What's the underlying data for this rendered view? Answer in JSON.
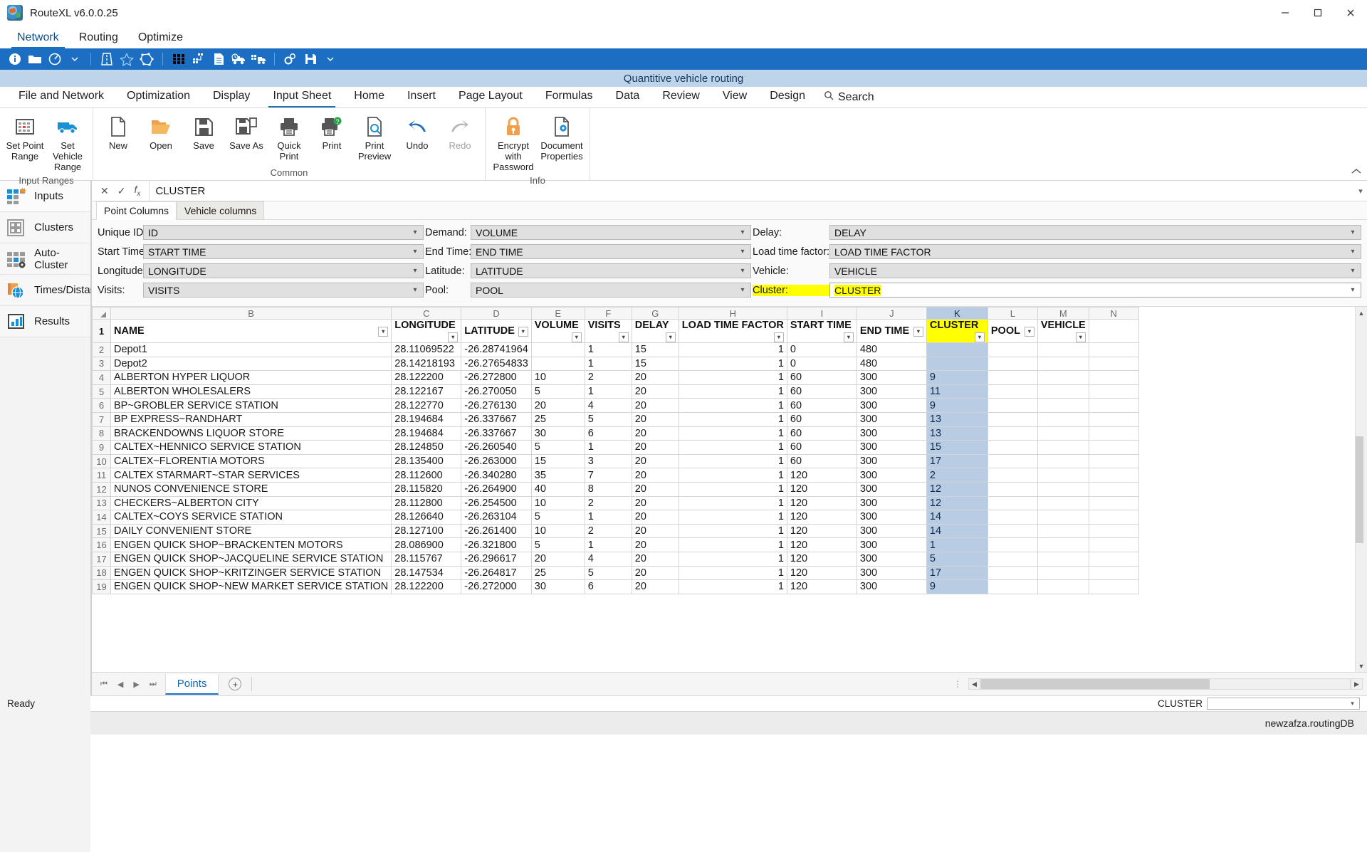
{
  "window": {
    "title": "RouteXL v6.0.0.25",
    "app_icon": "routexl-globe-icon",
    "minimize": "minimize-icon",
    "maximize": "maximize-icon",
    "close": "close-icon"
  },
  "menubar": {
    "items": [
      {
        "label": "Network",
        "active": true
      },
      {
        "label": "Routing",
        "active": false
      },
      {
        "label": "Optimize",
        "active": false
      }
    ]
  },
  "toolbar": {
    "icons": [
      "info-icon",
      "folder-open-icon",
      "compass-icon",
      "dropdown-caret-icon",
      "road-icon",
      "star-outline-icon",
      "polygon-icon",
      "grid-matrix-icon",
      "cluster-nodes-icon",
      "document-list-icon",
      "truck-clock-icon",
      "truck-network-icon",
      "gears-icon",
      "save-disk-icon",
      "more-caret-icon"
    ]
  },
  "caption": "Quantitive vehicle routing",
  "ribbon": {
    "tabs": [
      {
        "label": "File and Network",
        "active": false
      },
      {
        "label": "Optimization",
        "active": false
      },
      {
        "label": "Display",
        "active": false
      },
      {
        "label": "Input Sheet",
        "active": true
      },
      {
        "label": "Home",
        "active": false
      },
      {
        "label": "Insert",
        "active": false
      },
      {
        "label": "Page Layout",
        "active": false
      },
      {
        "label": "Formulas",
        "active": false
      },
      {
        "label": "Data",
        "active": false
      },
      {
        "label": "Review",
        "active": false
      },
      {
        "label": "View",
        "active": false
      },
      {
        "label": "Design",
        "active": false
      }
    ],
    "search_label": "Search",
    "search_icon": "search-icon",
    "groups": [
      {
        "title": "Input Ranges",
        "buttons": [
          {
            "label": "Set Point Range",
            "icon": "point-range-icon",
            "disabled": false
          },
          {
            "label": "Set Vehicle Range",
            "icon": "vehicle-range-icon",
            "disabled": false
          }
        ]
      },
      {
        "title": "Common",
        "buttons": [
          {
            "label": "New",
            "icon": "new-document-icon",
            "disabled": false
          },
          {
            "label": "Open",
            "icon": "open-folder-icon",
            "disabled": false
          },
          {
            "label": "Save",
            "icon": "save-disk-icon",
            "disabled": false
          },
          {
            "label": "Save As",
            "icon": "save-as-icon",
            "disabled": false
          },
          {
            "label": "Quick Print",
            "icon": "quick-print-icon",
            "disabled": false
          },
          {
            "label": "Print",
            "icon": "print-help-icon",
            "disabled": false
          },
          {
            "label": "Print Preview",
            "icon": "print-preview-icon",
            "disabled": false
          },
          {
            "label": "Undo",
            "icon": "undo-arrow-icon",
            "disabled": false
          },
          {
            "label": "Redo",
            "icon": "redo-arrow-icon",
            "disabled": true
          }
        ]
      },
      {
        "title": "Info",
        "buttons": [
          {
            "label": "Encrypt with Password",
            "icon": "lock-key-icon",
            "disabled": false
          },
          {
            "label": "Document Properties",
            "icon": "document-properties-icon",
            "disabled": false
          }
        ]
      }
    ]
  },
  "sidebar": {
    "items": [
      {
        "label": "Inputs",
        "icon": "inputs-icon",
        "selected": true
      },
      {
        "label": "Clusters",
        "icon": "clusters-icon",
        "selected": false
      },
      {
        "label": "Auto-Cluster",
        "icon": "auto-cluster-icon",
        "selected": false
      },
      {
        "label": "Times/Distances",
        "icon": "times-distances-icon",
        "selected": false
      },
      {
        "label": "Results",
        "icon": "results-chart-icon",
        "selected": false
      }
    ]
  },
  "formula_bar": {
    "cancel_icon": "cancel-x-icon",
    "confirm_icon": "confirm-check-icon",
    "function_icon": "fx-icon",
    "value": "CLUSTER",
    "expand_icon": "expand-caret-icon"
  },
  "config_panel": {
    "tabs": [
      {
        "label": "Point Columns",
        "active": true
      },
      {
        "label": "Vehicle columns",
        "active": false
      }
    ],
    "fields": [
      {
        "label": "Unique ID:",
        "value": "ID",
        "highlight_label": false,
        "highlight_value": false,
        "style": "combo"
      },
      {
        "label": "Demand:",
        "value": "VOLUME",
        "highlight_label": false,
        "highlight_value": false,
        "style": "combo"
      },
      {
        "label": "Delay:",
        "value": "DELAY",
        "highlight_label": false,
        "highlight_value": false,
        "style": "combo"
      },
      {
        "label": "Start Time:",
        "value": "START TIME",
        "highlight_label": false,
        "highlight_value": false,
        "style": "combo"
      },
      {
        "label": "End Time:",
        "value": "END TIME",
        "highlight_label": false,
        "highlight_value": false,
        "style": "combo"
      },
      {
        "label": "Load time factor:",
        "value": "LOAD TIME FACTOR",
        "highlight_label": false,
        "highlight_value": false,
        "style": "combo"
      },
      {
        "label": "Longitude:",
        "value": "LONGITUDE",
        "highlight_label": false,
        "highlight_value": false,
        "style": "combo"
      },
      {
        "label": "Latitude:",
        "value": "LATITUDE",
        "highlight_label": false,
        "highlight_value": false,
        "style": "combo"
      },
      {
        "label": "Vehicle:",
        "value": "VEHICLE",
        "highlight_label": false,
        "highlight_value": false,
        "style": "combo"
      },
      {
        "label": "Visits:",
        "value": "VISITS",
        "highlight_label": false,
        "highlight_value": false,
        "style": "combo"
      },
      {
        "label": "Pool:",
        "value": "POOL",
        "highlight_label": false,
        "highlight_value": false,
        "style": "combo"
      },
      {
        "label": "Cluster:",
        "value": "CLUSTER",
        "highlight_label": true,
        "highlight_value": true,
        "style": "plain"
      }
    ]
  },
  "sheet": {
    "column_letters": [
      "B",
      "C",
      "D",
      "E",
      "F",
      "G",
      "H",
      "I",
      "J",
      "K",
      "L",
      "M",
      "N"
    ],
    "headers": [
      "NAME",
      "LONGITUDE",
      "LATITUDE",
      "VOLUME",
      "VISITS",
      "DELAY",
      "LOAD TIME FACTOR",
      "START TIME",
      "END TIME",
      "CLUSTER",
      "POOL",
      "VEHICLE",
      ""
    ],
    "header_row_number": "1",
    "selected_column": "K",
    "selected_column_header": "CLUSTER",
    "rows": [
      {
        "n": "2",
        "cells": [
          "Depot1",
          "28.11069522",
          "-26.28741964",
          "",
          "1",
          "15",
          "1",
          "0",
          "480",
          "",
          "",
          "",
          ""
        ]
      },
      {
        "n": "3",
        "cells": [
          "Depot2",
          "28.14218193",
          "-26.27654833",
          "",
          "1",
          "15",
          "1",
          "0",
          "480",
          "",
          "",
          "",
          ""
        ]
      },
      {
        "n": "4",
        "cells": [
          "ALBERTON HYPER LIQUOR",
          "28.122200",
          "-26.272800",
          "10",
          "2",
          "20",
          "1",
          "60",
          "300",
          "9",
          "",
          "",
          ""
        ]
      },
      {
        "n": "5",
        "cells": [
          "ALBERTON WHOLESALERS",
          "28.122167",
          "-26.270050",
          "5",
          "1",
          "20",
          "1",
          "60",
          "300",
          "11",
          "",
          "",
          ""
        ]
      },
      {
        "n": "6",
        "cells": [
          "BP~GROBLER SERVICE STATION",
          "28.122770",
          "-26.276130",
          "20",
          "4",
          "20",
          "1",
          "60",
          "300",
          "9",
          "",
          "",
          ""
        ]
      },
      {
        "n": "7",
        "cells": [
          "BP EXPRESS~RANDHART",
          "28.194684",
          "-26.337667",
          "25",
          "5",
          "20",
          "1",
          "60",
          "300",
          "13",
          "",
          "",
          ""
        ]
      },
      {
        "n": "8",
        "cells": [
          "BRACKENDOWNS LIQUOR STORE",
          "28.194684",
          "-26.337667",
          "30",
          "6",
          "20",
          "1",
          "60",
          "300",
          "13",
          "",
          "",
          ""
        ]
      },
      {
        "n": "9",
        "cells": [
          "CALTEX~HENNICO SERVICE STATION",
          "28.124850",
          "-26.260540",
          "5",
          "1",
          "20",
          "1",
          "60",
          "300",
          "15",
          "",
          "",
          ""
        ]
      },
      {
        "n": "10",
        "cells": [
          "CALTEX~FLORENTIA MOTORS",
          "28.135400",
          "-26.263000",
          "15",
          "3",
          "20",
          "1",
          "60",
          "300",
          "17",
          "",
          "",
          ""
        ]
      },
      {
        "n": "11",
        "cells": [
          "CALTEX STARMART~STAR SERVICES",
          "28.112600",
          "-26.340280",
          "35",
          "7",
          "20",
          "1",
          "120",
          "300",
          "2",
          "",
          "",
          ""
        ]
      },
      {
        "n": "12",
        "cells": [
          "NUNOS CONVENIENCE STORE",
          "28.115820",
          "-26.264900",
          "40",
          "8",
          "20",
          "1",
          "120",
          "300",
          "12",
          "",
          "",
          ""
        ]
      },
      {
        "n": "13",
        "cells": [
          "CHECKERS~ALBERTON CITY",
          "28.112800",
          "-26.254500",
          "10",
          "2",
          "20",
          "1",
          "120",
          "300",
          "12",
          "",
          "",
          ""
        ]
      },
      {
        "n": "14",
        "cells": [
          "CALTEX~COYS SERVICE STATION",
          "28.126640",
          "-26.263104",
          "5",
          "1",
          "20",
          "1",
          "120",
          "300",
          "14",
          "",
          "",
          ""
        ]
      },
      {
        "n": "15",
        "cells": [
          "DAILY CONVENIENT STORE",
          "28.127100",
          "-26.261400",
          "10",
          "2",
          "20",
          "1",
          "120",
          "300",
          "14",
          "",
          "",
          ""
        ]
      },
      {
        "n": "16",
        "cells": [
          "ENGEN QUICK SHOP~BRACKENTEN MOTORS",
          "28.086900",
          "-26.321800",
          "5",
          "1",
          "20",
          "1",
          "120",
          "300",
          "1",
          "",
          "",
          ""
        ]
      },
      {
        "n": "17",
        "cells": [
          "ENGEN QUICK SHOP~JACQUELINE SERVICE STATION",
          "28.115767",
          "-26.296617",
          "20",
          "4",
          "20",
          "1",
          "120",
          "300",
          "5",
          "",
          "",
          ""
        ]
      },
      {
        "n": "18",
        "cells": [
          "ENGEN QUICK SHOP~KRITZINGER SERVICE STATION",
          "28.147534",
          "-26.264817",
          "25",
          "5",
          "20",
          "1",
          "120",
          "300",
          "17",
          "",
          "",
          ""
        ]
      },
      {
        "n": "19",
        "cells": [
          "ENGEN QUICK SHOP~NEW MARKET SERVICE STATION",
          "28.122200",
          "-26.272000",
          "30",
          "6",
          "20",
          "1",
          "120",
          "300",
          "9",
          "",
          "",
          ""
        ]
      }
    ]
  },
  "tabbar": {
    "first_icon": "first-sheet-icon",
    "prev_icon": "prev-sheet-icon",
    "next_icon": "next-sheet-icon",
    "last_icon": "last-sheet-icon",
    "sheets": [
      {
        "label": "Points",
        "active": true
      }
    ],
    "add_sheet_icon": "add-sheet-icon",
    "grip_icon": "scroll-grip-icon",
    "left_arrow_icon": "scroll-left-icon",
    "right_arrow_icon": "scroll-right-icon"
  },
  "statusbar": {
    "message": "Ready",
    "combo_label": "CLUSTER",
    "combo_value": "",
    "combo_chevron": "chevron-down-icon"
  },
  "bottombar": {
    "database": "newzafza.routingDB"
  }
}
